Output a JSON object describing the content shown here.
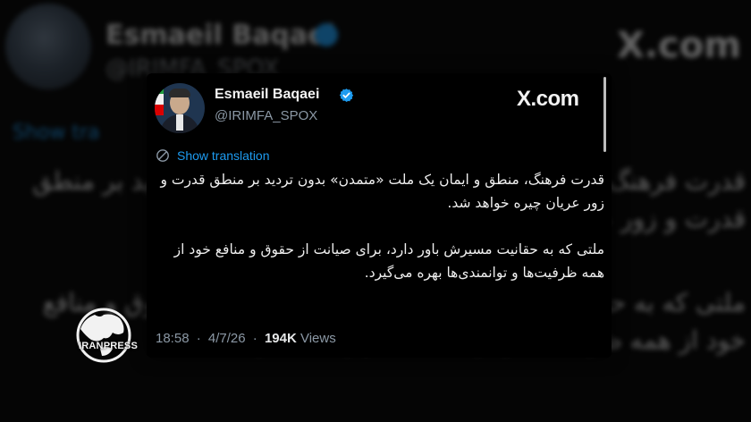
{
  "tweet": {
    "author_name": "Esmaeil Baqaei",
    "handle": "@IRIMFA_SPOX",
    "source_label": "X.com",
    "show_translation_label": "Show translation",
    "paragraphs": [
      "قدرت فرهنگ، منطق و ایمان یک ملت «متمدن» بدون تردید بر منطق قدرت و زور عریان چیره خواهد شد.",
      "ملتی که به حقانیت مسیرش باور دارد، برای صیانت از حقوق و منافع خود از همه ظرفیت‌ها و توانمندی‌ها بهره می‌گیرد."
    ],
    "time": "18:58",
    "date": "4/7/26",
    "views_count": "194K",
    "views_label": "Views",
    "separator": "·"
  },
  "background": {
    "author_name": "Esmaeil Baqaei",
    "handle": "@IRIMFA_SPOX",
    "source_label": "X.com",
    "show_translation_label": "Show tra",
    "paragraphs": [
      "قدرت فرهنگ، منطق و ایمان یک ملت «متمدن» بدون تردید بر منطق قدرت و زور عریان چیره خواهد شد.",
      "ملتی که به حقانیت مسیرش باور دارد، برای صیانت از حقوق و منافع خود از همه ظرفیت‌ها و توانمندی‌ها بهره می‌گیرد."
    ]
  },
  "watermark": {
    "brand": "IRANPRESS"
  },
  "icons": {
    "verified": "verified-badge-icon",
    "translate": "translate-icon",
    "avatar": "avatar"
  },
  "colors": {
    "accent": "#1d9bf0",
    "background": "#000000",
    "text": "#e7e9ea",
    "muted": "#8b98a5"
  }
}
